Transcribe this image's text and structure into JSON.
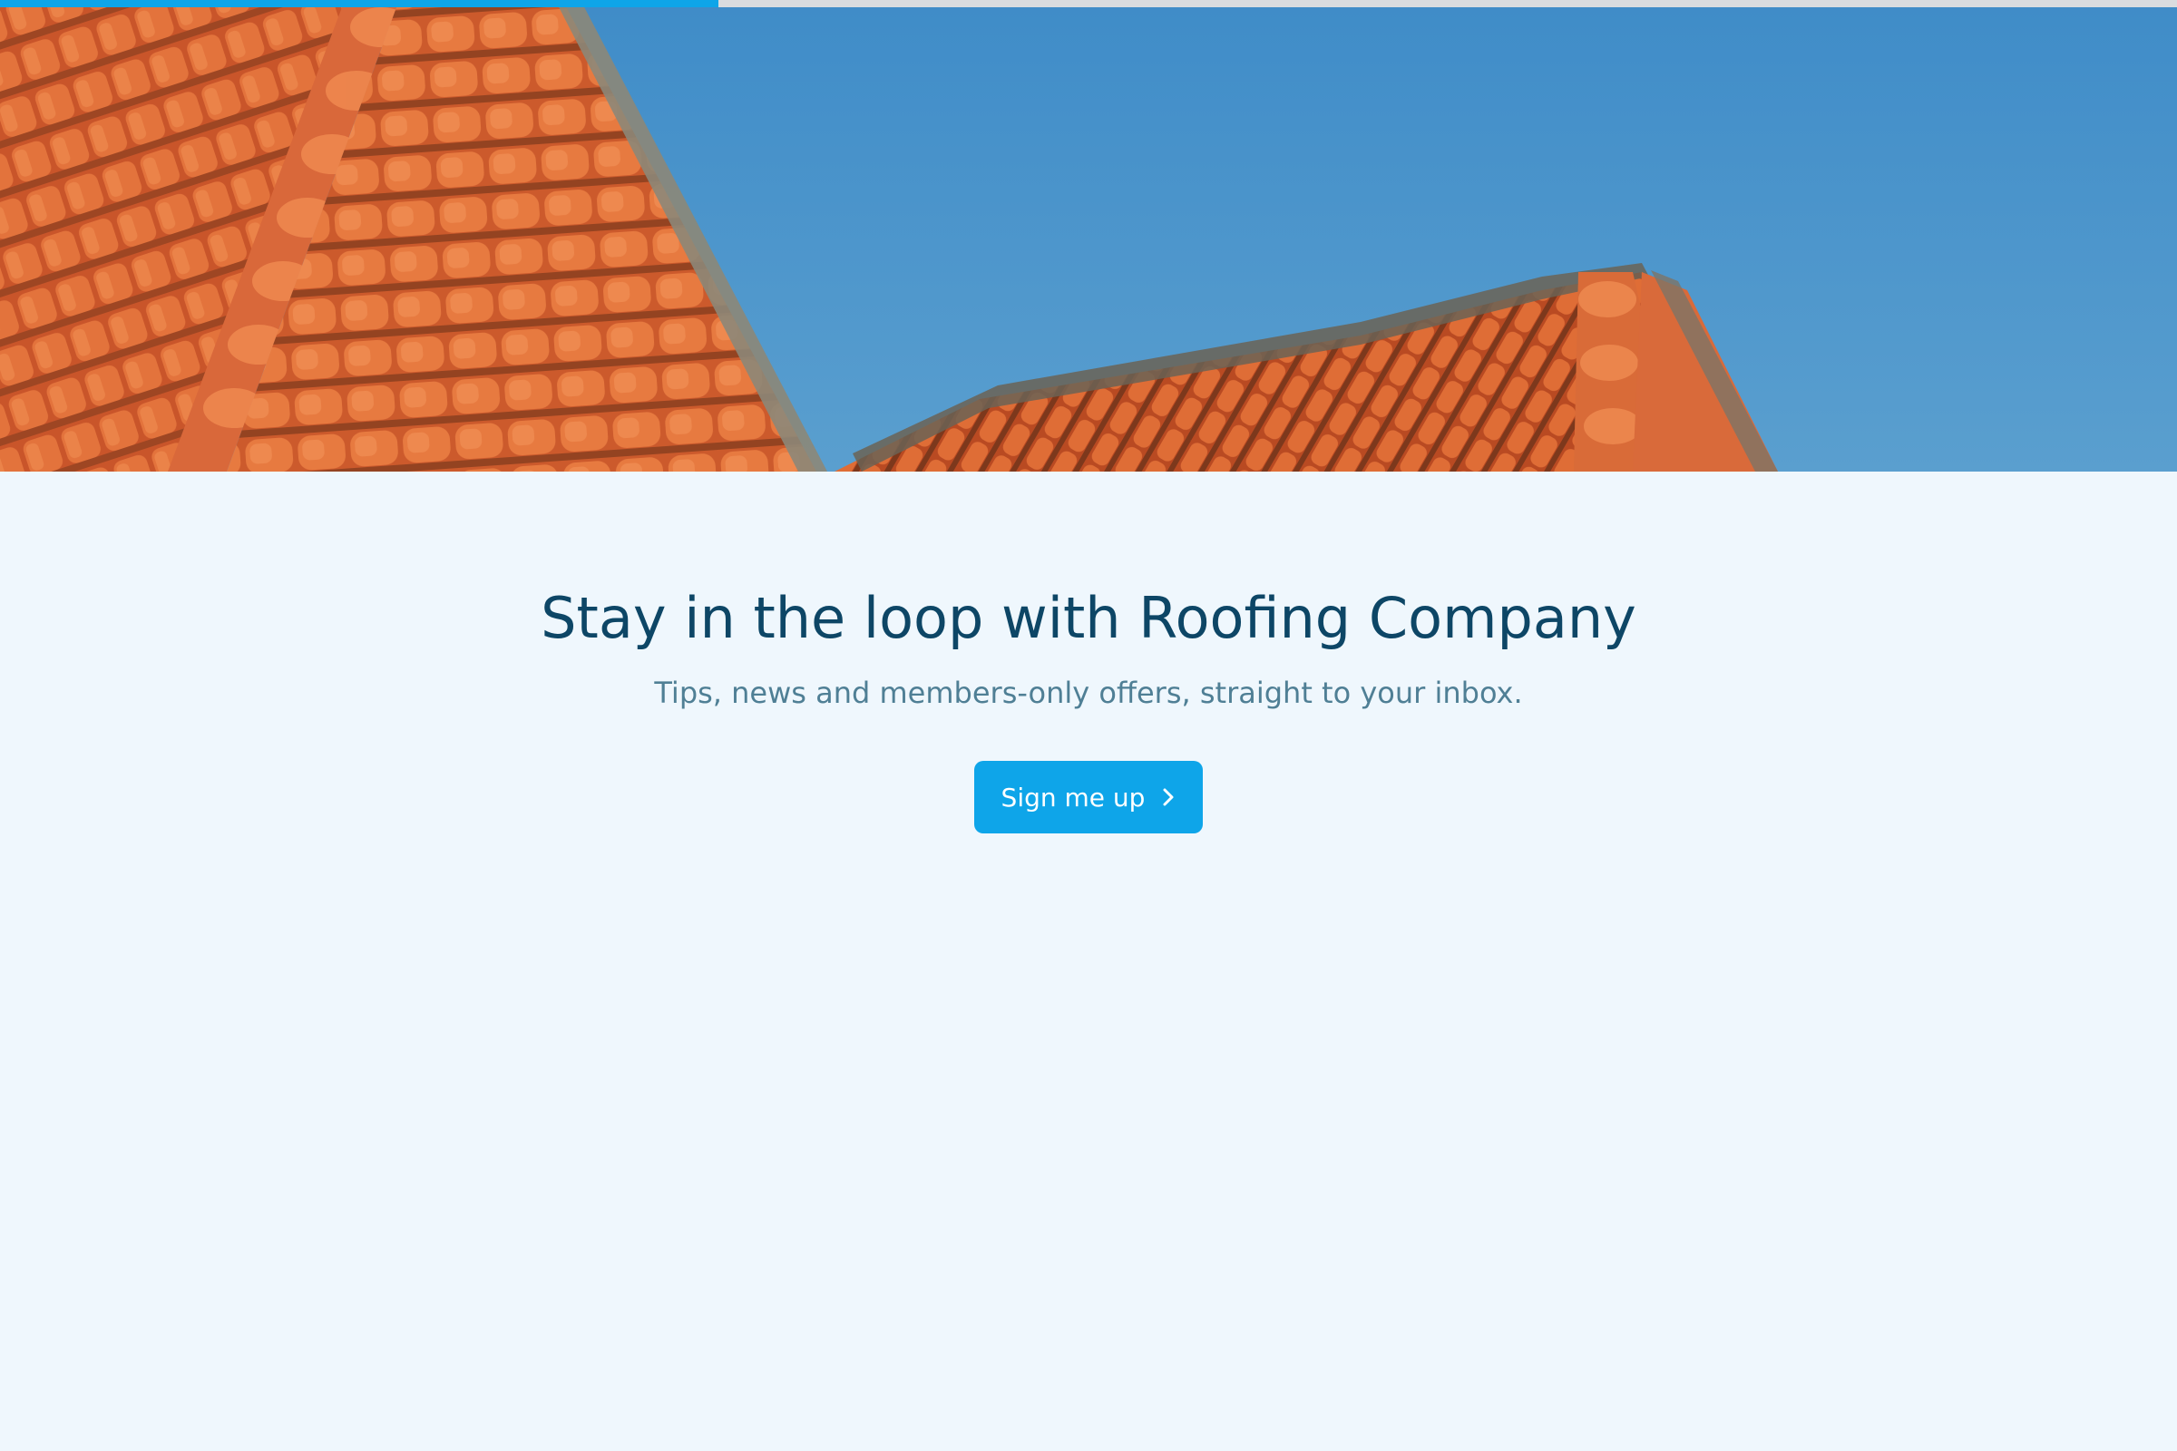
{
  "progress": {
    "fraction": 0.33,
    "fill_color": "#0ea5e9",
    "track_color": "#d9dcdf"
  },
  "hero": {
    "image": "roof-tiles-against-blue-sky",
    "sky_color": "#4690c8",
    "tile_color": "#d8642e"
  },
  "newsletter": {
    "headline": "Stay in the loop with Roofing Company",
    "subline": "Tips, news and members-only offers, straight to your inbox.",
    "button_label": "Sign me up",
    "button_icon": "chevron-right-icon",
    "accent_color": "#0ea5e9"
  },
  "colors": {
    "page_background": "#eff7fd",
    "headline": "#0d4666",
    "subline": "#4f7f95"
  }
}
